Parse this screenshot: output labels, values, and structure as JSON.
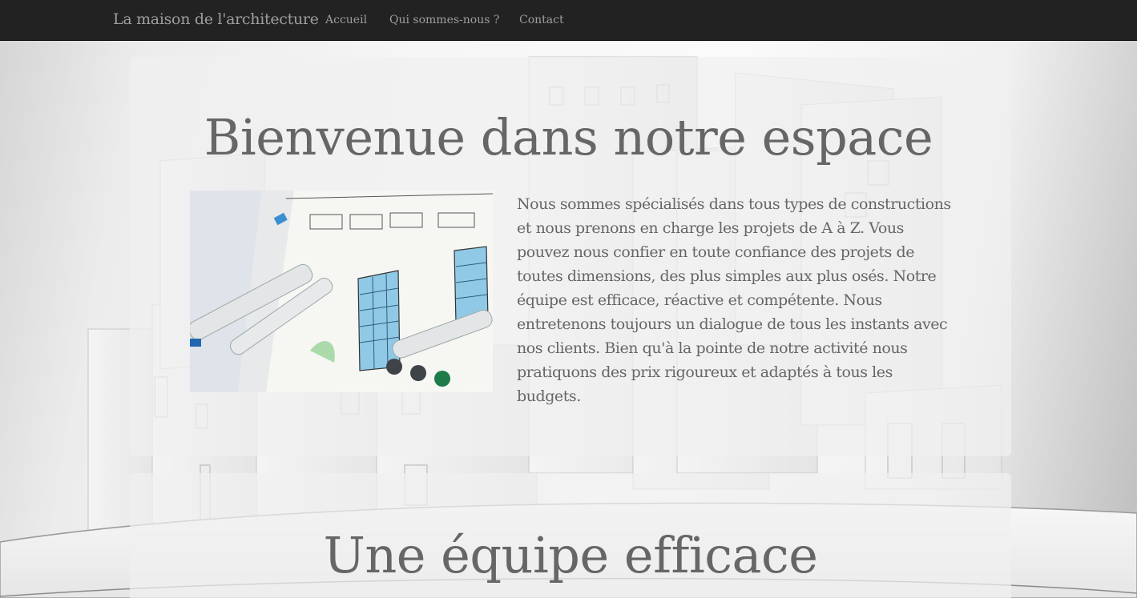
{
  "navbar": {
    "brand": "La maison de l'architecture",
    "links": [
      "Accueil",
      "Qui sommes-nous ?",
      "Contact"
    ]
  },
  "welcome": {
    "title": "Bienvenue dans notre espace",
    "text": "Nous sommes spécialisés dans tous types de constructions et nous prenons en charge les projets de A à Z. Vous pouvez nous confier en toute confiance des projets de toutes dimensions, des plus simples aux plus osés. Notre équipe est efficace, réactive et compétente. Nous entretenons toujours un dialogue de tous les instants avec nos clients. Bien qu'à la pointe de notre activité nous pratiquons des prix rigoureux et adaptés à tous les budgets."
  },
  "team": {
    "title": "Une équipe efficace"
  },
  "colors": {
    "navbar_bg": "#222222",
    "nav_text": "#9d9d9d",
    "heading_text": "#666666",
    "body_text": "#666666"
  },
  "icons": {
    "photo": "architecture-sketch-markers"
  }
}
